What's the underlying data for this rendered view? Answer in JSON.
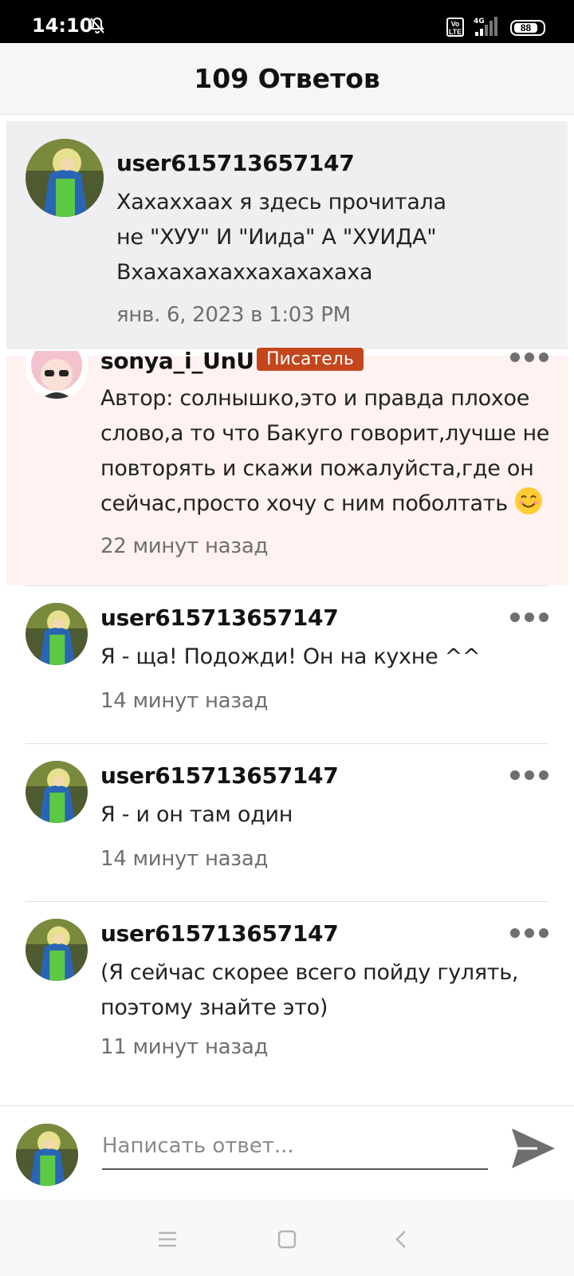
{
  "status_bar": {
    "time": "14:10",
    "battery": "88",
    "network": "4G",
    "volte": "Vo LTE"
  },
  "header": {
    "title": "109 Ответов"
  },
  "parent_comment": {
    "username": "user615713657147",
    "text_lines": [
      "Хахаххаах я здесь прочитала",
      "не \"ХУУ\" И \"Иида\" А \"ХУИДА\"",
      "Вхахахахаххахахахаха"
    ],
    "timestamp": "янв. 6, 2023 в 1:03 PM"
  },
  "replies": [
    {
      "username": "sonya_i_UnU",
      "badge": "Писатель",
      "text_lines": [
        "Автор: солнышко,это и правда плохое",
        "слово,а то что Бакуго говорит,лучше не",
        "повторять и скажи пожалуйста,где он",
        "сейчас,просто хочу с ним поболтать"
      ],
      "emoji": "smiling-face-emoji",
      "timestamp": "22 минут назад"
    },
    {
      "username": "user615713657147",
      "text_lines": [
        "Я - ща! Подожди! Он на кухне ^^"
      ],
      "timestamp": "14 минут назад"
    },
    {
      "username": "user615713657147",
      "text_lines": [
        "Я - и он там один"
      ],
      "timestamp": "14 минут назад"
    },
    {
      "username": "user615713657147",
      "text_lines": [
        "(Я сейчас скорее всего пойду гулять,",
        "поэтому знайте это)"
      ],
      "timestamp": "11 минут назад"
    }
  ],
  "reply_bar": {
    "placeholder": "Написать ответ..."
  },
  "colors": {
    "author_highlight": "#fff2f0",
    "parent_highlight": "#efeff1",
    "badge": "#c3461c"
  }
}
